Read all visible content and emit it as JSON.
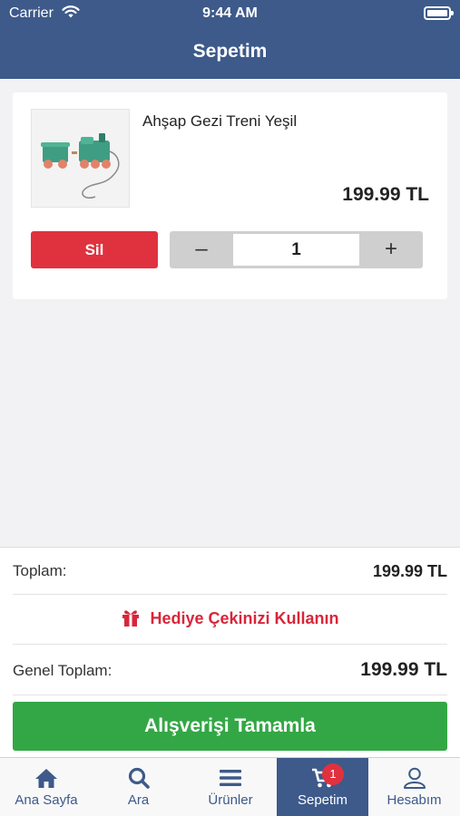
{
  "status_bar": {
    "carrier": "Carrier",
    "time": "9:44 AM"
  },
  "nav": {
    "title": "Sepetim"
  },
  "cart_item": {
    "name": "Ahşap Gezi Treni Yeşil",
    "price": "199.99 TL",
    "delete_label": "Sil",
    "quantity": "1",
    "minus_label": "–",
    "plus_label": "+"
  },
  "summary": {
    "subtotal_label": "Toplam:",
    "subtotal_value": "199.99 TL",
    "gift_label": "Hediye Çekinizi Kullanın",
    "grand_total_label": "Genel Toplam:",
    "grand_total_value": "199.99 TL",
    "checkout_label": "Alışverişi Tamamla"
  },
  "tabs": [
    {
      "label": "Ana Sayfa",
      "icon": "home-icon"
    },
    {
      "label": "Ara",
      "icon": "search-icon"
    },
    {
      "label": "Ürünler",
      "icon": "menu-icon"
    },
    {
      "label": "Sepetim",
      "icon": "cart-icon",
      "badge": "1",
      "active": true
    },
    {
      "label": "Hesabım",
      "icon": "user-icon"
    }
  ],
  "colors": {
    "primary": "#3d5a8a",
    "danger": "#e0313e",
    "success": "#33a745",
    "background": "#f2f2f4"
  }
}
